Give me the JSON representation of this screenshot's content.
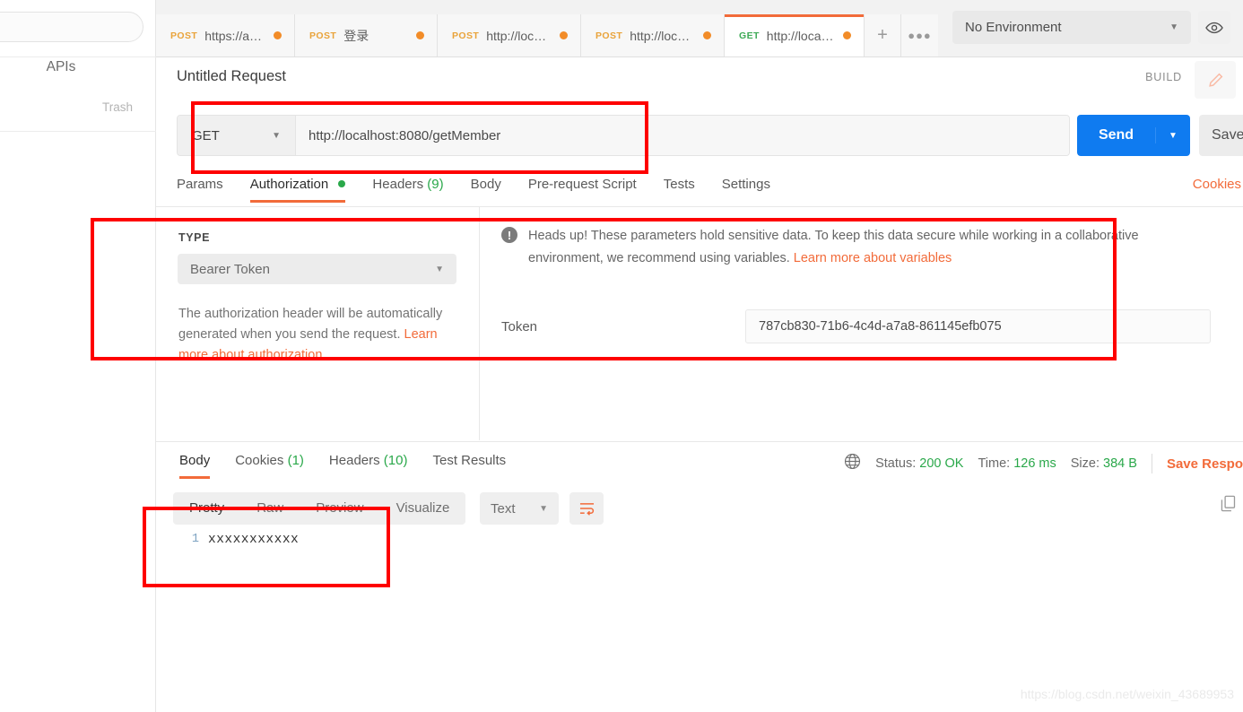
{
  "sidebar": {
    "search_placeholder": "",
    "apis_label": "APIs",
    "trash_label": "Trash"
  },
  "topbar": {
    "tabs": [
      {
        "method": "POST",
        "label": "https://api....",
        "unsaved": true,
        "active": false
      },
      {
        "method": "POST",
        "label": "登录",
        "unsaved": true,
        "active": false
      },
      {
        "method": "POST",
        "label": "http://local...",
        "unsaved": true,
        "active": false
      },
      {
        "method": "POST",
        "label": "http://local...",
        "unsaved": true,
        "active": false
      },
      {
        "method": "GET",
        "label": "http://localh...",
        "unsaved": true,
        "active": true
      }
    ],
    "add_label": "+",
    "more_label": "●●●",
    "environment": "No Environment",
    "env_caret": "▼",
    "eye_icon": "◎"
  },
  "request": {
    "title": "Untitled Request",
    "build_label": "BUILD",
    "method": "GET",
    "method_caret": "▼",
    "url": "http://localhost:8080/getMember",
    "send_label": "Send",
    "send_caret": "▼",
    "save_label": "Save",
    "cookies_link": "Cookies",
    "tabs": [
      {
        "label": "Params",
        "active": false,
        "dot": false,
        "count": ""
      },
      {
        "label": "Authorization",
        "active": true,
        "dot": true,
        "count": ""
      },
      {
        "label": "Headers",
        "active": false,
        "dot": false,
        "count": "(9)"
      },
      {
        "label": "Body",
        "active": false,
        "dot": false,
        "count": ""
      },
      {
        "label": "Pre-request Script",
        "active": false,
        "dot": false,
        "count": ""
      },
      {
        "label": "Tests",
        "active": false,
        "dot": false,
        "count": ""
      },
      {
        "label": "Settings",
        "active": false,
        "dot": false,
        "count": ""
      }
    ]
  },
  "auth": {
    "type_label": "TYPE",
    "type_value": "Bearer Token",
    "type_caret": "▼",
    "note_text": "The authorization header will be automatically generated when you send the request. ",
    "note_link": "Learn more about authorization",
    "headsup_icon": "!",
    "headsup_text": "Heads up! These parameters hold sensitive data. To keep this data secure while working in a collaborative environment, we recommend using variables. ",
    "headsup_link": "Learn more about variables",
    "token_label": "Token",
    "token_value": "787cb830-71b6-4c4d-a7a8-861145efb075"
  },
  "response": {
    "tabs": [
      {
        "label": "Body",
        "count": "",
        "active": true
      },
      {
        "label": "Cookies",
        "count": "(1)",
        "active": false
      },
      {
        "label": "Headers",
        "count": "(10)",
        "active": false
      },
      {
        "label": "Test Results",
        "count": "",
        "active": false
      }
    ],
    "globe_icon": "⊕",
    "status_label": "Status:",
    "status_value": "200 OK",
    "time_label": "Time:",
    "time_value": "126 ms",
    "size_label": "Size:",
    "size_value": "384 B",
    "save_response": "Save Respo",
    "formats": [
      {
        "label": "Pretty",
        "active": true
      },
      {
        "label": "Raw",
        "active": false
      },
      {
        "label": "Preview",
        "active": false
      },
      {
        "label": "Visualize",
        "active": false
      }
    ],
    "format_type": "Text",
    "format_caret": "▼",
    "body_lines": [
      {
        "no": "1",
        "code": "xxxxxxxxxxx"
      }
    ]
  },
  "watermark": "https://blog.csdn.net/weixin_43689953",
  "colors": {
    "accent_orange": "#f26b3a",
    "send_blue": "#0f7bf0",
    "success_green": "#2aa84a",
    "post_amber": "#e9a33a",
    "get_green": "#3eaa56",
    "annotation_red": "#fe0000"
  }
}
